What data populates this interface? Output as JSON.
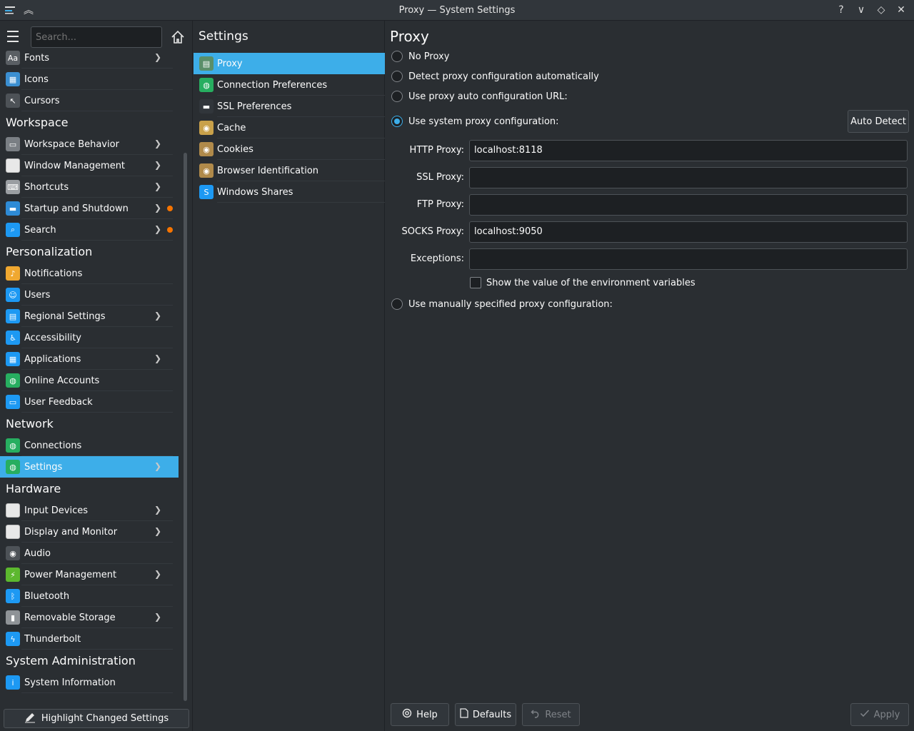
{
  "window": {
    "title": "Proxy — System Settings",
    "help_glyph": "?",
    "minimize_glyph": "∨",
    "maximize_glyph": "◇",
    "close_glyph": "✕",
    "collapse_glyph": "︽"
  },
  "sidebar": {
    "search_placeholder": "Search...",
    "items": [
      {
        "type": "item",
        "label": "Fonts",
        "icon": "fonts-icon",
        "chevron": true
      },
      {
        "type": "item",
        "label": "Icons",
        "icon": "icons-icon"
      },
      {
        "type": "item",
        "label": "Cursors",
        "icon": "cursor-icon"
      },
      {
        "type": "section",
        "label": "Workspace"
      },
      {
        "type": "item",
        "label": "Workspace Behavior",
        "icon": "workspace-icon",
        "chevron": true
      },
      {
        "type": "item",
        "label": "Window Management",
        "icon": "window-icon",
        "chevron": true
      },
      {
        "type": "item",
        "label": "Shortcuts",
        "icon": "keyboard-icon",
        "chevron": true
      },
      {
        "type": "item",
        "label": "Startup and Shutdown",
        "icon": "startup-icon",
        "chevron": true,
        "dot": true
      },
      {
        "type": "item",
        "label": "Search",
        "icon": "search-icon",
        "chevron": true,
        "dot": true
      },
      {
        "type": "section",
        "label": "Personalization"
      },
      {
        "type": "item",
        "label": "Notifications",
        "icon": "bell-icon"
      },
      {
        "type": "item",
        "label": "Users",
        "icon": "users-icon"
      },
      {
        "type": "item",
        "label": "Regional Settings",
        "icon": "regional-icon",
        "chevron": true
      },
      {
        "type": "item",
        "label": "Accessibility",
        "icon": "accessibility-icon"
      },
      {
        "type": "item",
        "label": "Applications",
        "icon": "applications-icon",
        "chevron": true
      },
      {
        "type": "item",
        "label": "Online Accounts",
        "icon": "globe-icon"
      },
      {
        "type": "item",
        "label": "User Feedback",
        "icon": "feedback-icon"
      },
      {
        "type": "section",
        "label": "Network"
      },
      {
        "type": "item",
        "label": "Connections",
        "icon": "globe-icon"
      },
      {
        "type": "item",
        "label": "Settings",
        "icon": "network-settings-icon",
        "chevron": true,
        "active": true
      },
      {
        "type": "section",
        "label": "Hardware"
      },
      {
        "type": "item",
        "label": "Input Devices",
        "icon": "input-devices-icon",
        "chevron": true
      },
      {
        "type": "item",
        "label": "Display and Monitor",
        "icon": "monitor-icon",
        "chevron": true
      },
      {
        "type": "item",
        "label": "Audio",
        "icon": "speaker-icon"
      },
      {
        "type": "item",
        "label": "Power Management",
        "icon": "power-icon",
        "chevron": true
      },
      {
        "type": "item",
        "label": "Bluetooth",
        "icon": "bluetooth-icon"
      },
      {
        "type": "item",
        "label": "Removable Storage",
        "icon": "usb-icon",
        "chevron": true
      },
      {
        "type": "item",
        "label": "Thunderbolt",
        "icon": "thunderbolt-icon"
      },
      {
        "type": "section",
        "label": "System Administration"
      },
      {
        "type": "item",
        "label": "System Information",
        "icon": "info-icon"
      }
    ],
    "highlight_button": "Highlight Changed Settings"
  },
  "middle": {
    "title": "Settings",
    "items": [
      {
        "label": "Proxy",
        "icon": "proxy-icon",
        "active": true
      },
      {
        "label": "Connection Preferences",
        "icon": "globe-icon"
      },
      {
        "label": "SSL Preferences",
        "icon": "ssl-icon"
      },
      {
        "label": "Cache",
        "icon": "cache-icon"
      },
      {
        "label": "Cookies",
        "icon": "cookies-icon"
      },
      {
        "label": "Browser Identification",
        "icon": "browser-id-icon"
      },
      {
        "label": "Windows Shares",
        "icon": "windows-shares-icon"
      }
    ]
  },
  "proxy": {
    "title": "Proxy",
    "options": {
      "no_proxy": "No Proxy",
      "auto_detect": "Detect proxy configuration automatically",
      "auto_url": "Use proxy auto configuration URL:",
      "system": "Use system proxy configuration:",
      "manual": "Use manually specified proxy configuration:"
    },
    "selected": "system",
    "auto_detect_button": "Auto Detect",
    "fields": {
      "http_label": "HTTP Proxy:",
      "http_value": "localhost:8118",
      "ssl_label": "SSL Proxy:",
      "ssl_value": "",
      "ftp_label": "FTP Proxy:",
      "ftp_value": "",
      "socks_label": "SOCKS Proxy:",
      "socks_value": "localhost:9050",
      "exceptions_label": "Exceptions:",
      "exceptions_value": ""
    },
    "show_env_checkbox": "Show the value of the environment variables",
    "show_env_checked": false
  },
  "footer": {
    "help": "Help",
    "defaults": "Defaults",
    "reset": "Reset",
    "apply": "Apply"
  },
  "colors": {
    "accent": "#3daee9",
    "background": "#2a2e32",
    "changed_dot": "#f67400"
  }
}
